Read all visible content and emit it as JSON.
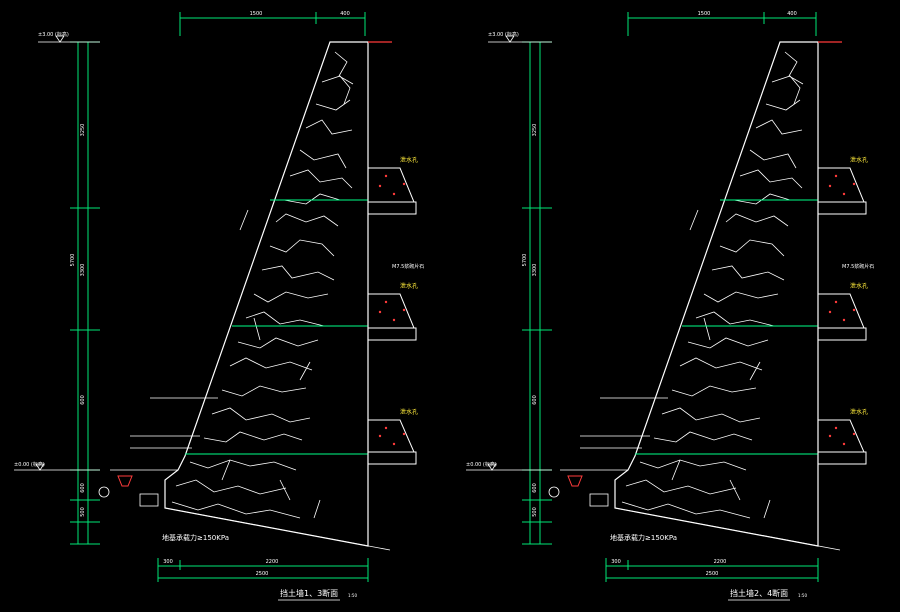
{
  "colors": {
    "background": "#000000",
    "linework": "#ffffff",
    "dimension": "#00e676",
    "accent_red": "#ff3b3b",
    "label_yellow": "#ffeb3b",
    "masonry_joint": "#ffffff",
    "ground_line": "#00ff88"
  },
  "sections": [
    {
      "id": "left",
      "title": "挡土墙1、3断面",
      "scale": "1:50",
      "bearing_note": "地基承载力≥150KPa",
      "top_dims": [
        "1500",
        "400"
      ],
      "bottom_dims": [
        "300",
        "2200"
      ],
      "total_width": "2500",
      "elevation_top": "±3.00 (标高)",
      "elevation_base": "±0.00 (标高)",
      "left_dims": [
        "3250",
        "3300",
        "5700",
        "600",
        "600",
        "500"
      ],
      "material_note": "M7.5浆砌片石",
      "labels": [
        "泄水孔",
        "泄水孔",
        "泄水孔"
      ]
    },
    {
      "id": "right",
      "title": "挡土墙2、4断面",
      "scale": "1:50",
      "bearing_note": "地基承载力≥150KPa",
      "top_dims": [
        "1500",
        "400"
      ],
      "bottom_dims": [
        "300",
        "2200"
      ],
      "total_width": "2500",
      "elevation_top": "±3.00 (标高)",
      "elevation_base": "±0.00 (标高)",
      "left_dims": [
        "3250",
        "3300",
        "5700",
        "600",
        "600",
        "500"
      ],
      "material_note": "M7.5浆砌片石",
      "labels": [
        "泄水孔",
        "泄水孔",
        "泄水孔"
      ]
    }
  ]
}
